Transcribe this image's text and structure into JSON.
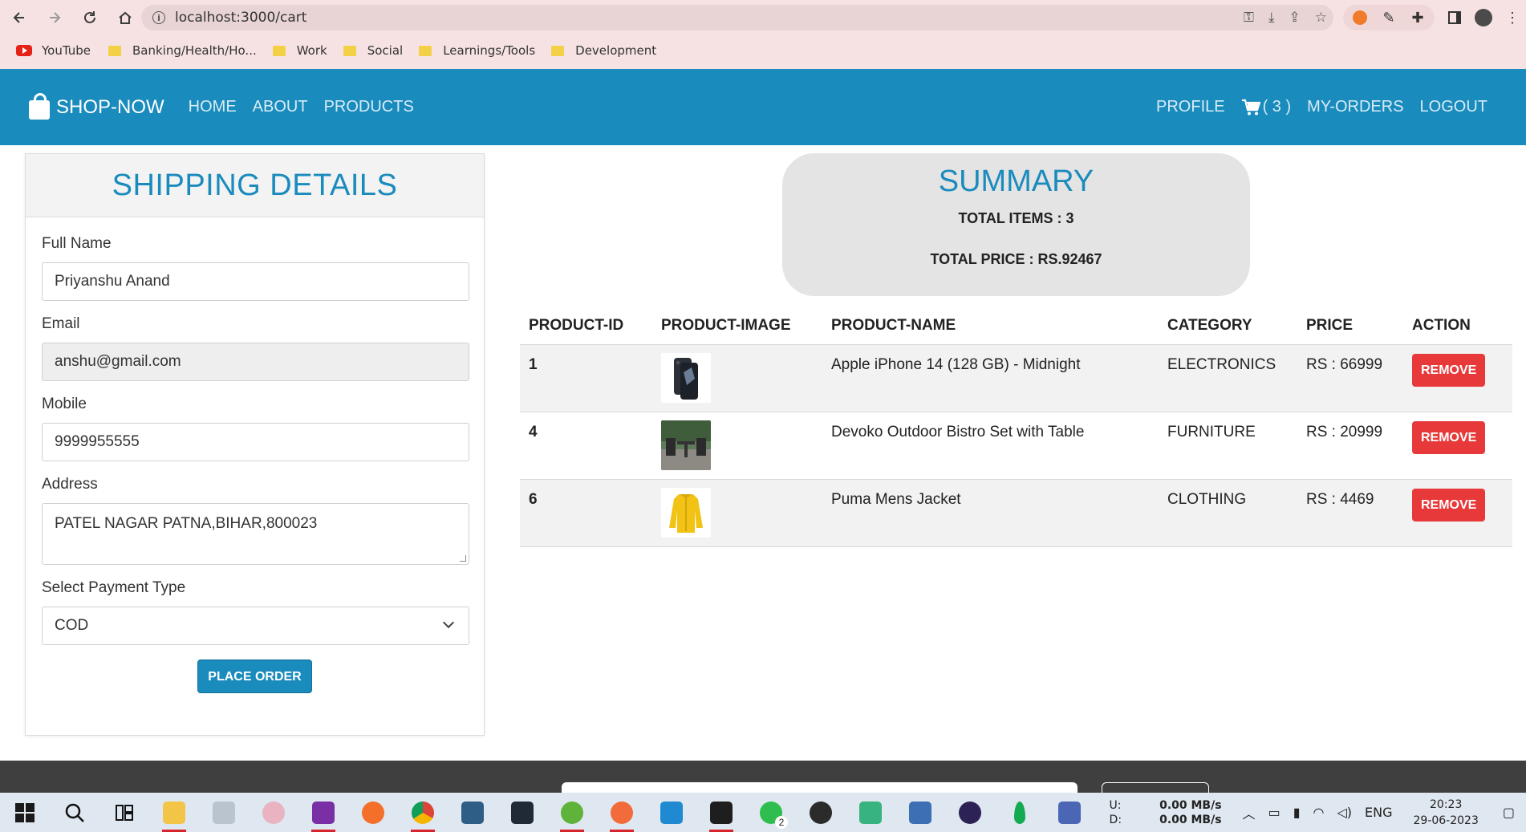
{
  "browser": {
    "url": "localhost:3000/cart",
    "bookmarks": [
      {
        "label": "YouTube",
        "type": "youtube"
      },
      {
        "label": "Banking/Health/Ho...",
        "type": "folder"
      },
      {
        "label": "Work",
        "type": "folder"
      },
      {
        "label": "Social",
        "type": "folder"
      },
      {
        "label": "Learnings/Tools",
        "type": "folder"
      },
      {
        "label": "Development",
        "type": "folder"
      }
    ]
  },
  "navbar": {
    "brand": "SHOP-NOW",
    "links": {
      "home": "HOME",
      "about": "ABOUT",
      "products": "PRODUCTS"
    },
    "profile": "PROFILE",
    "cart_count": "( 3 )",
    "my_orders": "MY-ORDERS",
    "logout": "LOGOUT"
  },
  "shipping": {
    "title": "SHIPPING DETAILS",
    "full_name": {
      "label": "Full Name",
      "value": "Priyanshu Anand"
    },
    "email": {
      "label": "Email",
      "value": "anshu@gmail.com"
    },
    "mobile": {
      "label": "Mobile",
      "value": "9999955555"
    },
    "address": {
      "label": "Address",
      "value": "PATEL NAGAR PATNA,BIHAR,800023"
    },
    "payment": {
      "label": "Select Payment Type",
      "value": "COD"
    },
    "place_order": "PLACE ORDER"
  },
  "summary": {
    "title": "SUMMARY",
    "total_items": "TOTAL ITEMS : 3",
    "total_price": "TOTAL PRICE : RS.92467"
  },
  "table": {
    "headers": [
      "PRODUCT-ID",
      "PRODUCT-IMAGE",
      "PRODUCT-NAME",
      "CATEGORY",
      "PRICE",
      "ACTION"
    ],
    "rows": [
      {
        "id": "1",
        "name": "Apple iPhone 14 (128 GB) - Midnight",
        "category": "ELECTRONICS",
        "price": "RS : 66999",
        "action": "REMOVE",
        "image": "phone"
      },
      {
        "id": "4",
        "name": "Devoko Outdoor Bistro Set with Table",
        "category": "FURNITURE",
        "price": "RS : 20999",
        "action": "REMOVE",
        "image": "bistro-set"
      },
      {
        "id": "6",
        "name": "Puma Mens Jacket",
        "category": "CLOTHING",
        "price": "RS : 4469",
        "action": "REMOVE",
        "image": "jacket"
      }
    ]
  },
  "taskbar": {
    "net_up_label": "U:",
    "net_up": "0.00 MB/s",
    "net_down_label": "D:",
    "net_down": "0.00 MB/s",
    "lang": "ENG",
    "time": "20:23",
    "date": "29-06-2023",
    "whatsapp_badge": "2"
  },
  "colors": {
    "primary": "#1a8bbd",
    "danger": "#e8393a",
    "summary_bg": "#e4e4e4"
  }
}
